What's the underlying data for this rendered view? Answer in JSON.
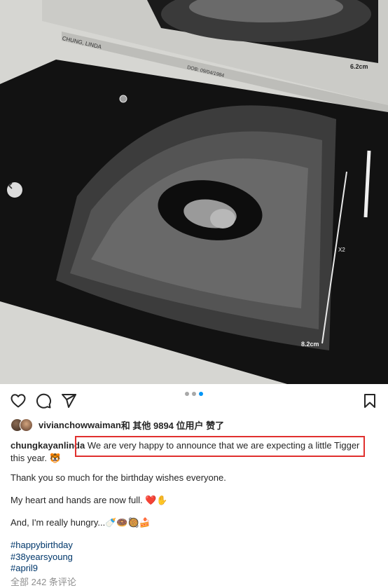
{
  "photo": {
    "patient_name": "CHUNG, LINDA",
    "dob": "DOB: 09/04/1984",
    "scale_top": "6.2cm",
    "scale_bottom": "8.2cm",
    "zoom_marker": "X2"
  },
  "carousel": {
    "dot_count": 3,
    "active_index": 2
  },
  "likes": {
    "liker": "vivianchowwaiman",
    "others": " 和 其他 9894 位用户 赞了"
  },
  "caption": {
    "username": "chungkayanlinda",
    "text": "We are very happy to announce that we are expecting a little Tigger this year. 🐯"
  },
  "post_lines": {
    "thanks": "Thank you so much for the birthday wishes everyone.",
    "heart": "My heart and hands are now full. ❤️✋",
    "hungry": "And, I'm really hungry...🍼🍩🥘🍰"
  },
  "hashtags": [
    "#happybirthday",
    "#38yearsyoung",
    "#april9"
  ],
  "comments_link": "全部 242 条评论",
  "icons": [
    "heart-icon",
    "comment-icon",
    "share-icon",
    "bookmark-icon",
    "chevron-left-icon"
  ],
  "colors": {
    "accent": "#0095f6",
    "hashtag": "#00376b",
    "highlight": "#e0302e"
  }
}
